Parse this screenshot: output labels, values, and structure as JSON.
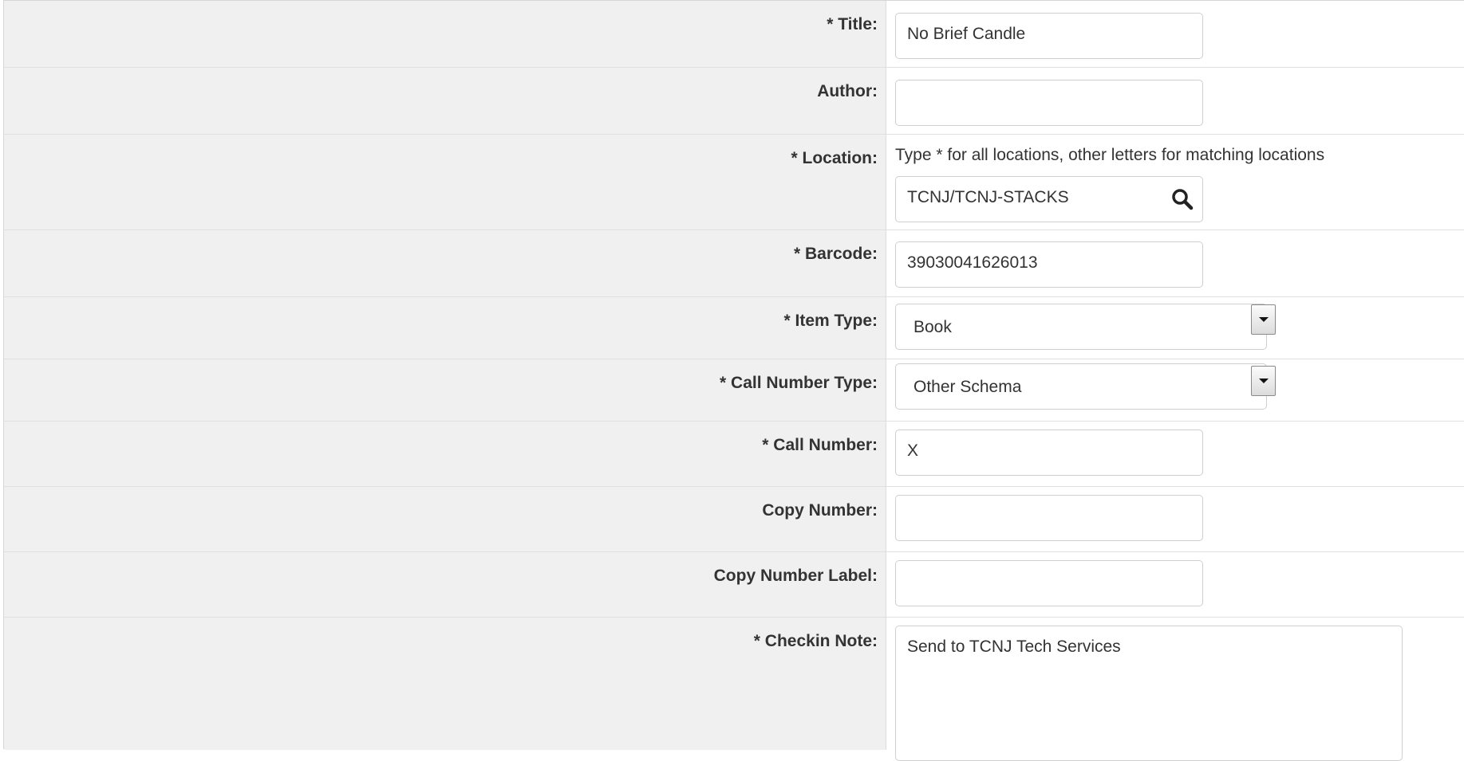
{
  "form": {
    "title": {
      "label": "* Title:",
      "value": "No Brief Candle"
    },
    "author": {
      "label": "Author:",
      "value": ""
    },
    "location": {
      "label": "* Location:",
      "hint": "Type * for all locations, other letters for matching locations",
      "value": "TCNJ/TCNJ-STACKS",
      "icon": "search-icon"
    },
    "barcode": {
      "label": "* Barcode:",
      "value": "39030041626013"
    },
    "item_type": {
      "label": "* Item Type:",
      "value": "Book"
    },
    "call_number_type": {
      "label": "* Call Number Type:",
      "value": "Other Schema"
    },
    "call_number": {
      "label": "* Call Number:",
      "value": "X"
    },
    "copy_number": {
      "label": "Copy Number:",
      "value": ""
    },
    "copy_number_label": {
      "label": "Copy Number Label:",
      "value": ""
    },
    "checkin_note": {
      "label": "* Checkin Note:",
      "value": "Send to TCNJ Tech Services"
    }
  },
  "colors": {
    "label_background": "#f0f0f0",
    "value_background": "#ffffff",
    "text": "#333333",
    "border": "#cfcfcf"
  }
}
